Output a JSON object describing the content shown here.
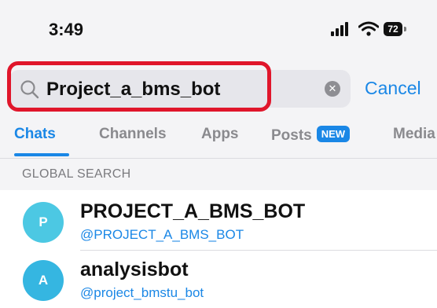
{
  "status_bar": {
    "time": "3:49",
    "battery_level": "72",
    "signal_icon": "cellular-signal-icon",
    "wifi_icon": "wifi-icon"
  },
  "search": {
    "query": "Project_a_bms_bot",
    "cancel_label": "Cancel",
    "highlight_color": "#e0162b"
  },
  "tabs": [
    {
      "label": "Chats",
      "active": true
    },
    {
      "label": "Channels",
      "active": false
    },
    {
      "label": "Apps",
      "active": false
    },
    {
      "label": "Posts",
      "active": false,
      "badge": "NEW"
    },
    {
      "label": "Media",
      "active": false
    }
  ],
  "section": {
    "title": "GLOBAL SEARCH"
  },
  "results": [
    {
      "initial": "P",
      "name": "PROJECT_A_BMS_BOT",
      "handle": "@PROJECT_A_BMS_BOT",
      "avatar_color": "#4cc8e3"
    },
    {
      "initial": "A",
      "name": "analysisbot",
      "handle": "@project_bmstu_bot",
      "avatar_color": "#35b6e1"
    }
  ],
  "colors": {
    "accent": "#1a87e6",
    "header_bg": "#f4f4f6"
  }
}
